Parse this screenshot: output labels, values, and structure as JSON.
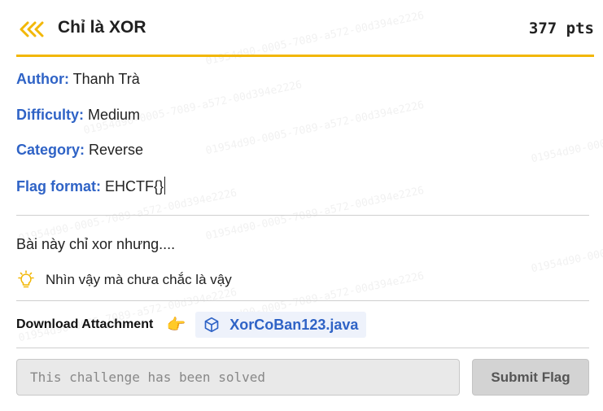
{
  "challenge": {
    "title": "Chỉ là XOR",
    "points": "377 pts",
    "accent_color": "#f2b705",
    "link_color": "#2f63c6"
  },
  "meta": {
    "author_label": "Author:",
    "author_value": "Thanh Trà",
    "difficulty_label": "Difficulty:",
    "difficulty_value": "Medium",
    "category_label": "Category:",
    "category_value": "Reverse",
    "flag_format_label": "Flag format:",
    "flag_format_value": "EHCTF{}"
  },
  "description": "Bài này chỉ xor nhưng....",
  "hint": {
    "icon": "lightbulb-icon",
    "text": "Nhìn vậy mà chưa chắc là vậy"
  },
  "download": {
    "label": "Download Attachment",
    "pointer_icon": "pointing-hand-icon",
    "file_icon": "cube-icon",
    "file_name": "XorCoBan123.java"
  },
  "submission": {
    "placeholder": "This challenge has been solved",
    "value": "",
    "button_label": "Submit Flag"
  },
  "watermark_text": "01954d90-0005-7089-a572-00d394e2226"
}
